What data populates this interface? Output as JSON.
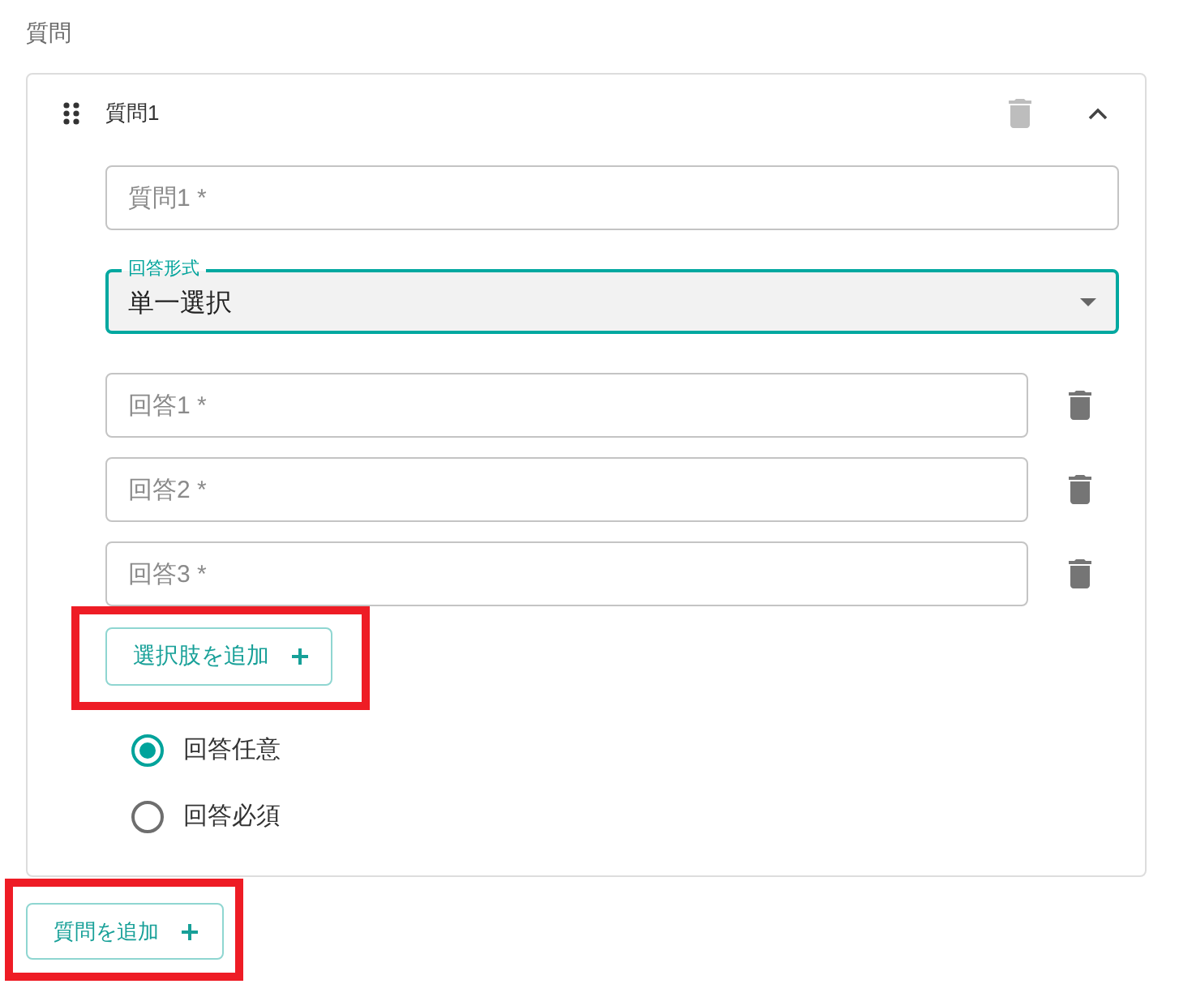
{
  "section_title": "質問",
  "questions": [
    {
      "title": "質問1",
      "expanded": true,
      "delete_disabled": true,
      "question_field": {
        "placeholder": "質問1 *"
      },
      "answer_format": {
        "label": "回答形式",
        "value": "単一選択",
        "focused": true
      },
      "choices": [
        {
          "placeholder": "回答1 *"
        },
        {
          "placeholder": "回答2 *"
        },
        {
          "placeholder": "回答3 *"
        }
      ],
      "add_choice_button": {
        "label": "選択肢を追加",
        "highlighted": true
      },
      "requirement_options": [
        {
          "label": "回答任意",
          "selected": true
        },
        {
          "label": "回答必須",
          "selected": false
        }
      ]
    }
  ],
  "add_question_button": {
    "label": "質問を追加",
    "highlighted": true
  }
}
